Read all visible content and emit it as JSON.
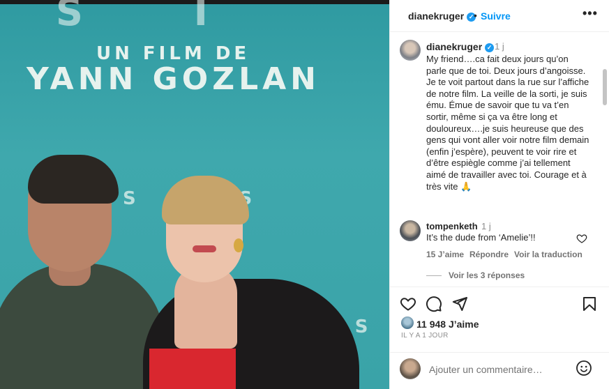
{
  "photo": {
    "film_line1": "UN FILM DE",
    "film_line2": "YANN GOZLAN",
    "bg_text_top": "S I",
    "bg_text_mid": "S I S",
    "bg_text_low": "V I S"
  },
  "header": {
    "username": "dianekruger",
    "separator": "•",
    "follow_label": "Suivre",
    "more_label": "•••"
  },
  "caption": {
    "username": "dianekruger",
    "time": "1 j",
    "text": "My friend….ca fait deux jours qu’on parle que de toi. Deux jours d’angoisse. Je te voit partout dans la rue sur l’affiche de notre film. La veille de la sorti, je suis ému. Émue de savoir que tu va t’en sortir, même si ça va être long et douloureux….je suis heureuse que des gens qui vont aller voir notre film demain (enfin j’espère), peuvent te voir rire et d’être espiègle comme j’ai tellement aimé de travailler avec toi. Courage et à très vite 🙏"
  },
  "comment": {
    "username": "tompenketh",
    "time": "1 j",
    "text": "It’s the dude from ‘Amelie’!!",
    "likes": "15 J’aime",
    "reply_label": "Répondre",
    "translate_label": "Voir la traduction",
    "replies_label": "Voir les 3 réponses"
  },
  "actions": {
    "likes_count": "11 948 J’aime",
    "post_date": "IL Y A 1 JOUR"
  },
  "add_comment": {
    "placeholder": "Ajouter un commentaire…"
  },
  "icons": {
    "like": "heart-icon",
    "comment": "comment-bubble-icon",
    "share": "paper-plane-icon",
    "save": "bookmark-icon",
    "emoji": "smiley-icon",
    "verified": "verified-badge-icon",
    "more": "more-options-icon"
  },
  "colors": {
    "accent": "#0095f6",
    "verified": "#1d9bf0",
    "muted_text": "#8e8e8e",
    "photo_background": "#3aa3a8"
  }
}
